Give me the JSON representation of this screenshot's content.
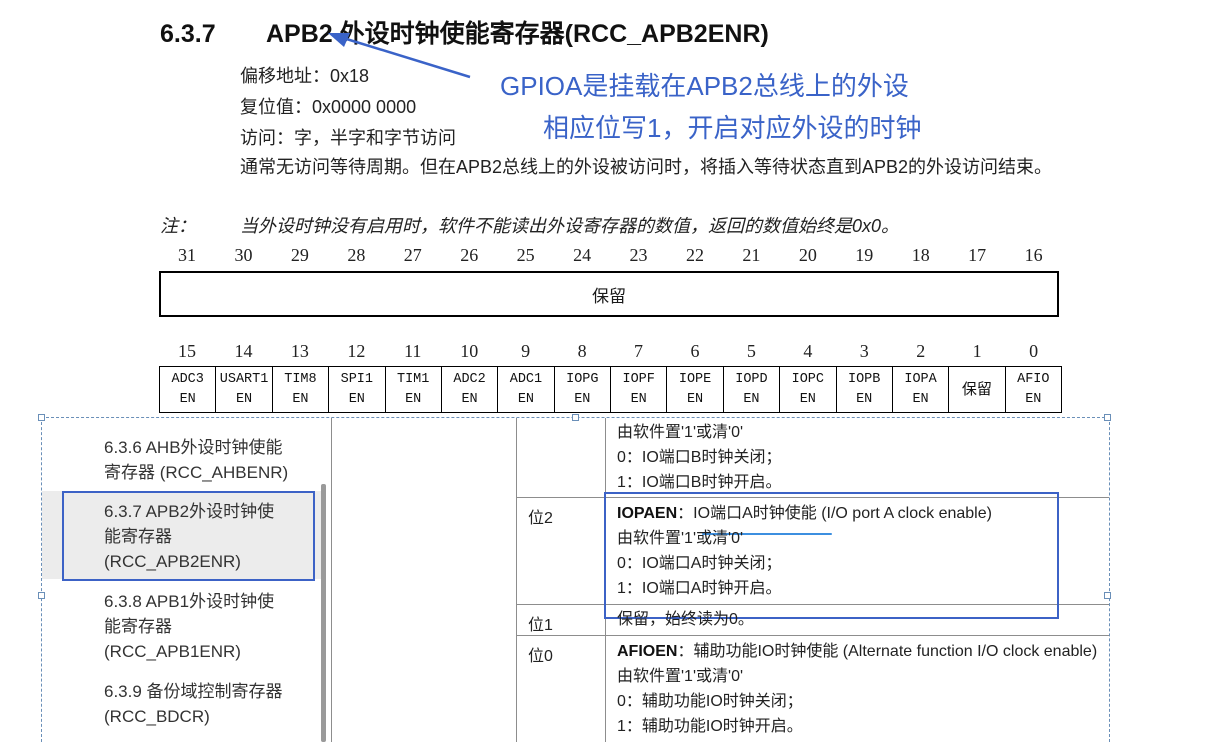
{
  "section": {
    "number": "6.3.7",
    "title": "APB2 外设时钟使能寄存器(RCC_APB2ENR)"
  },
  "meta": {
    "offset": "偏移地址：0x18",
    "reset": "复位值：0x0000 0000",
    "access": "访问：字，半字和字节访问"
  },
  "paragraph": "通常无访问等待周期。但在APB2总线上的外设被访问时，将插入等待状态直到APB2的外设访问结束。",
  "note": {
    "label": "注：",
    "text": "当外设时钟没有启用时，软件不能读出外设寄存器的数值，返回的数值始终是0x0。"
  },
  "annotation": {
    "line1": "GPIOA是挂载在APB2总线上的外设",
    "line2": "相应位写1，开启对应外设的时钟",
    "color": "#3a63c8"
  },
  "register": {
    "upper_bits": [
      "31",
      "30",
      "29",
      "28",
      "27",
      "26",
      "25",
      "24",
      "23",
      "22",
      "21",
      "20",
      "19",
      "18",
      "17",
      "16"
    ],
    "upper_field": "保留",
    "lower_bits": [
      "15",
      "14",
      "13",
      "12",
      "11",
      "10",
      "9",
      "8",
      "7",
      "6",
      "5",
      "4",
      "3",
      "2",
      "1",
      "0"
    ],
    "lower_fields": [
      {
        "l1": "ADC3",
        "l2": "EN"
      },
      {
        "l1": "USART1",
        "l2": "EN"
      },
      {
        "l1": "TIM8",
        "l2": "EN"
      },
      {
        "l1": "SPI1",
        "l2": "EN"
      },
      {
        "l1": "TIM1",
        "l2": "EN"
      },
      {
        "l1": "ADC2",
        "l2": "EN"
      },
      {
        "l1": "ADC1",
        "l2": "EN"
      },
      {
        "l1": "IOPG",
        "l2": "EN"
      },
      {
        "l1": "IOPF",
        "l2": "EN"
      },
      {
        "l1": "IOPE",
        "l2": "EN"
      },
      {
        "l1": "IOPD",
        "l2": "EN"
      },
      {
        "l1": "IOPC",
        "l2": "EN"
      },
      {
        "l1": "IOPB",
        "l2": "EN"
      },
      {
        "l1": "IOPA",
        "l2": "EN"
      },
      {
        "l1": "保留",
        "l2": ""
      },
      {
        "l1": "AFIO",
        "l2": "EN"
      }
    ]
  },
  "toc": {
    "items": [
      {
        "line1": "6.3.6 AHB外设时钟使能",
        "line2": "寄存器 (RCC_AHBENR)",
        "line3": ""
      },
      {
        "line1": "6.3.7 APB2外设时钟使",
        "line2": "能寄存器",
        "line3": "(RCC_APB2ENR)"
      },
      {
        "line1": "6.3.8 APB1外设时钟使",
        "line2": "能寄存器",
        "line3": "(RCC_APB1ENR)"
      },
      {
        "line1": "6.3.9 备份域控制寄存器",
        "line2": "(RCC_BDCR)",
        "line3": ""
      }
    ],
    "active_index": 1
  },
  "bit_desc": {
    "top": {
      "l1": "由软件置'1'或清'0'",
      "l2": "0：IO端口B时钟关闭；",
      "l3": "1：IO端口B时钟开启。"
    },
    "bit2": {
      "label": "位2",
      "name": "IOPAEN",
      "sep": "：",
      "cn": "IO端口A时钟使能",
      "en": " (I/O port A clock enable)",
      "l1": "由软件置'1'或清'0'",
      "l2": "0：IO端口A时钟关闭；",
      "l3": "1：IO端口A时钟开启。"
    },
    "bit1": {
      "label": "位1",
      "text": "保留，始终读为0。"
    },
    "bit0": {
      "label": "位0",
      "name": "AFIOEN",
      "sep": "：",
      "rest": "辅助功能IO时钟使能 (Alternate function I/O clock enable)",
      "l1": "由软件置'1'或清'0'",
      "l2": "0：辅助功能IO时钟关闭；",
      "l3": "1：辅助功能IO时钟开启。"
    }
  }
}
